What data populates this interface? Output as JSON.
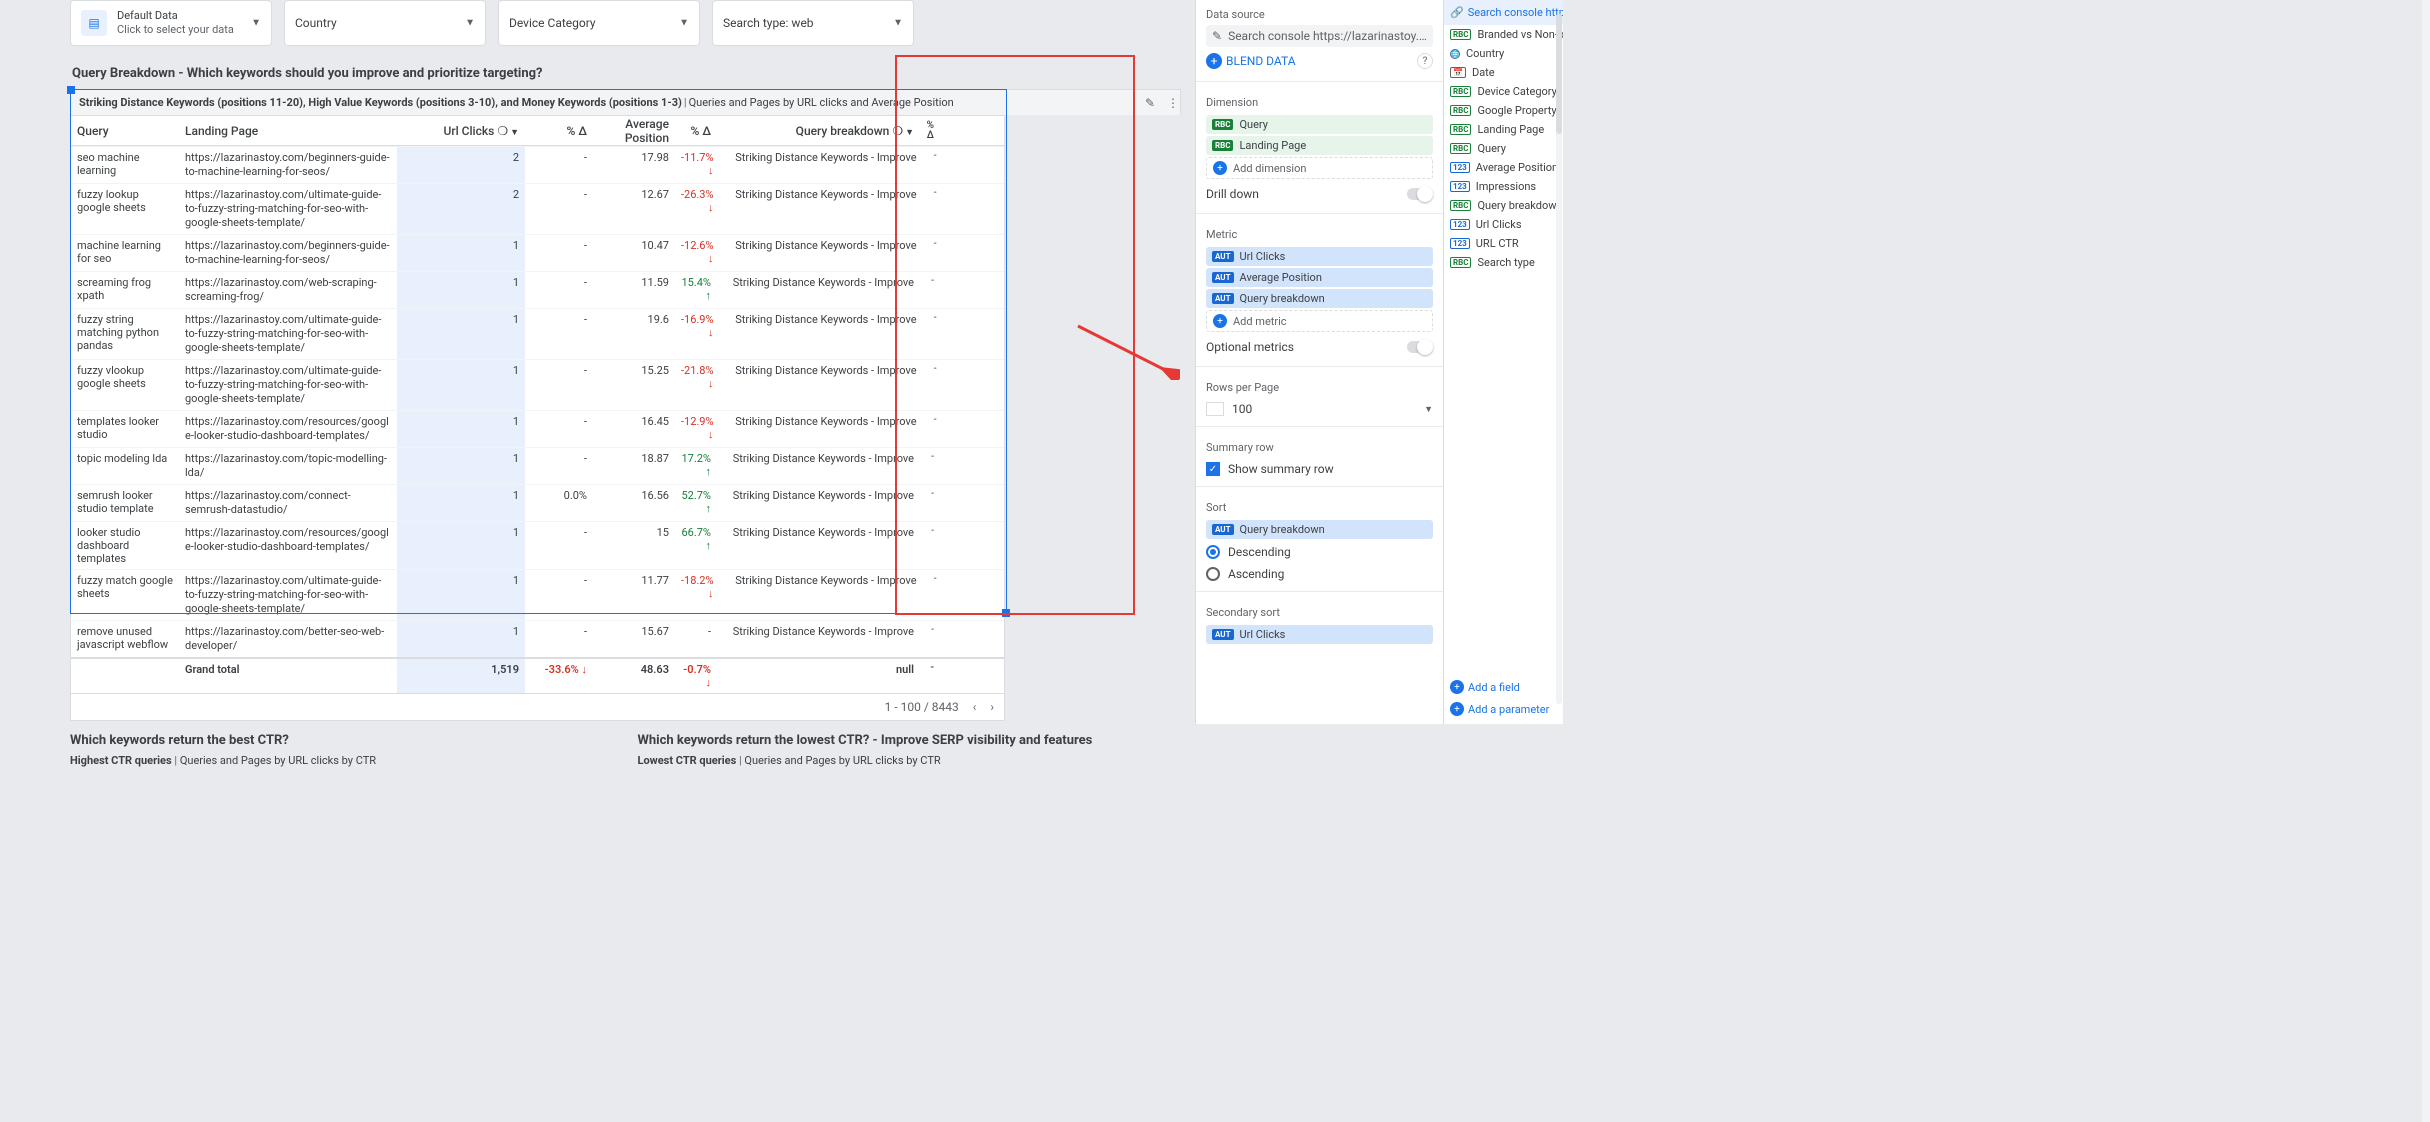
{
  "filters": {
    "data_label": "Default Data",
    "data_sub": "Click to select your data",
    "country": "Country",
    "device": "Device Category",
    "search": "Search type: web"
  },
  "main": {
    "title": "Query Breakdown - Which keywords should you improve and prioritize targeting?",
    "subtitle_strong": "Striking Distance Keywords (positions 11-20), High Value Keywords (positions 3-10), and Money Keywords (positions 1-3)",
    "subtitle_rest": "Queries and Pages by URL clicks and Average Position",
    "cols": {
      "query": "Query",
      "lp": "Landing Page",
      "clicks": "Url Clicks",
      "delta": "% Δ",
      "avg": "Average Position",
      "qb": "Query breakdown"
    },
    "rows": [
      {
        "q": "seo machine learning",
        "lp": "https://lazarinastoy.com/beginners-guide-to-machine-learning-for-seos/",
        "c": "2",
        "d1": "-",
        "avg": "17.98",
        "d2": "-11.7%",
        "dir2": "down",
        "qb": "Striking Distance Keywords - Improve",
        "d3": "-"
      },
      {
        "q": "fuzzy lookup google sheets",
        "lp": "https://lazarinastoy.com/ultimate-guide-to-fuzzy-string-matching-for-seo-with-google-sheets-template/",
        "c": "2",
        "d1": "-",
        "avg": "12.67",
        "d2": "-26.3%",
        "dir2": "down",
        "qb": "Striking Distance Keywords - Improve",
        "d3": "-"
      },
      {
        "q": "machine learning for seo",
        "lp": "https://lazarinastoy.com/beginners-guide-to-machine-learning-for-seos/",
        "c": "1",
        "d1": "-",
        "avg": "10.47",
        "d2": "-12.6%",
        "dir2": "down",
        "qb": "Striking Distance Keywords - Improve",
        "d3": "-"
      },
      {
        "q": "screaming frog xpath",
        "lp": "https://lazarinastoy.com/web-scraping-screaming-frog/",
        "c": "1",
        "d1": "-",
        "avg": "11.59",
        "d2": "15.4%",
        "dir2": "up",
        "qb": "Striking Distance Keywords - Improve",
        "d3": "-"
      },
      {
        "q": "fuzzy string matching python pandas",
        "lp": "https://lazarinastoy.com/ultimate-guide-to-fuzzy-string-matching-for-seo-with-google-sheets-template/",
        "c": "1",
        "d1": "-",
        "avg": "19.6",
        "d2": "-16.9%",
        "dir2": "down",
        "qb": "Striking Distance Keywords - Improve",
        "d3": "-"
      },
      {
        "q": "fuzzy vlookup google sheets",
        "lp": "https://lazarinastoy.com/ultimate-guide-to-fuzzy-string-matching-for-seo-with-google-sheets-template/",
        "c": "1",
        "d1": "-",
        "avg": "15.25",
        "d2": "-21.8%",
        "dir2": "down",
        "qb": "Striking Distance Keywords - Improve",
        "d3": "-"
      },
      {
        "q": "templates looker studio",
        "lp": "https://lazarinastoy.com/resources/google-looker-studio-dashboard-templates/",
        "c": "1",
        "d1": "-",
        "avg": "16.45",
        "d2": "-12.9%",
        "dir2": "down",
        "qb": "Striking Distance Keywords - Improve",
        "d3": "-"
      },
      {
        "q": "topic modeling lda",
        "lp": "https://lazarinastoy.com/topic-modelling-lda/",
        "c": "1",
        "d1": "-",
        "avg": "18.87",
        "d2": "17.2%",
        "dir2": "up",
        "qb": "Striking Distance Keywords - Improve",
        "d3": "-"
      },
      {
        "q": "semrush looker studio template",
        "lp": "https://lazarinastoy.com/connect-semrush-datastudio/",
        "c": "1",
        "d1": "0.0%",
        "avg": "16.56",
        "d2": "52.7%",
        "dir2": "up",
        "qb": "Striking Distance Keywords - Improve",
        "d3": "-"
      },
      {
        "q": "looker studio dashboard templates",
        "lp": "https://lazarinastoy.com/resources/google-looker-studio-dashboard-templates/",
        "c": "1",
        "d1": "-",
        "avg": "15",
        "d2": "66.7%",
        "dir2": "up",
        "qb": "Striking Distance Keywords - Improve",
        "d3": "-"
      },
      {
        "q": "fuzzy match google sheets",
        "lp": "https://lazarinastoy.com/ultimate-guide-to-fuzzy-string-matching-for-seo-with-google-sheets-template/",
        "c": "1",
        "d1": "-",
        "avg": "11.77",
        "d2": "-18.2%",
        "dir2": "down",
        "qb": "Striking Distance Keywords - Improve",
        "d3": "-"
      },
      {
        "q": "remove unused javascript webflow",
        "lp": "https://lazarinastoy.com/better-seo-web-developer/",
        "c": "1",
        "d1": "-",
        "avg": "15.67",
        "d2": "-",
        "dir2": "",
        "qb": "Striking Distance Keywords - Improve",
        "d3": "-"
      }
    ],
    "grand": {
      "label": "Grand total",
      "c": "1,519",
      "d1": "-33.6%",
      "dir1": "down",
      "avg": "48.63",
      "d2": "-0.7%",
      "dir2": "down",
      "qb": "null",
      "d3": "-"
    },
    "pager": "1 - 100 / 8443"
  },
  "below": {
    "left_title": "Which keywords return the best CTR?",
    "left_sub_strong": "Highest CTR queries",
    "left_sub_rest": "Queries and Pages by URL clicks by CTR",
    "right_title": "Which keywords return the lowest CTR? - Improve SERP visibility and features",
    "right_sub_strong": "Lowest CTR queries",
    "right_sub_rest": "Queries and Pages by URL clicks by CTR"
  },
  "panel": {
    "data_source": "Data source",
    "ds_name": "Search console https://lazarinastoy.com/",
    "blend": "BLEND DATA",
    "dimension": "Dimension",
    "dims": [
      "Query",
      "Landing Page"
    ],
    "add_dim": "Add dimension",
    "drill": "Drill down",
    "metric": "Metric",
    "metrics": [
      "Url Clicks",
      "Average Position",
      "Query breakdown"
    ],
    "add_metric": "Add metric",
    "optional": "Optional metrics",
    "rpp_label": "Rows per Page",
    "rpp_value": "100",
    "summary_label": "Summary row",
    "summary_check": "Show summary row",
    "sort": "Sort",
    "sort_field": "Query breakdown",
    "desc": "Descending",
    "asc": "Ascending",
    "sec_sort": "Secondary sort",
    "sec_sort_field": "Url Clicks"
  },
  "fields": {
    "head": "Search console https://laz",
    "items": [
      {
        "ic": "rbc",
        "label": "Branded vs Non-branded"
      },
      {
        "ic": "glb",
        "label": "Country"
      },
      {
        "ic": "cal",
        "label": "Date"
      },
      {
        "ic": "rbc",
        "label": "Device Category"
      },
      {
        "ic": "rbc",
        "label": "Google Property"
      },
      {
        "ic": "rbc",
        "label": "Landing Page"
      },
      {
        "ic": "rbc",
        "label": "Query"
      },
      {
        "ic": "num",
        "label": "Average Position"
      },
      {
        "ic": "num",
        "label": "Impressions"
      },
      {
        "ic": "rbc",
        "label": "Query breakdown"
      },
      {
        "ic": "num",
        "label": "Url Clicks"
      },
      {
        "ic": "num",
        "label": "URL CTR"
      },
      {
        "ic": "rbc",
        "label": "Search type"
      }
    ],
    "add_field": "Add a field",
    "add_param": "Add a parameter"
  }
}
